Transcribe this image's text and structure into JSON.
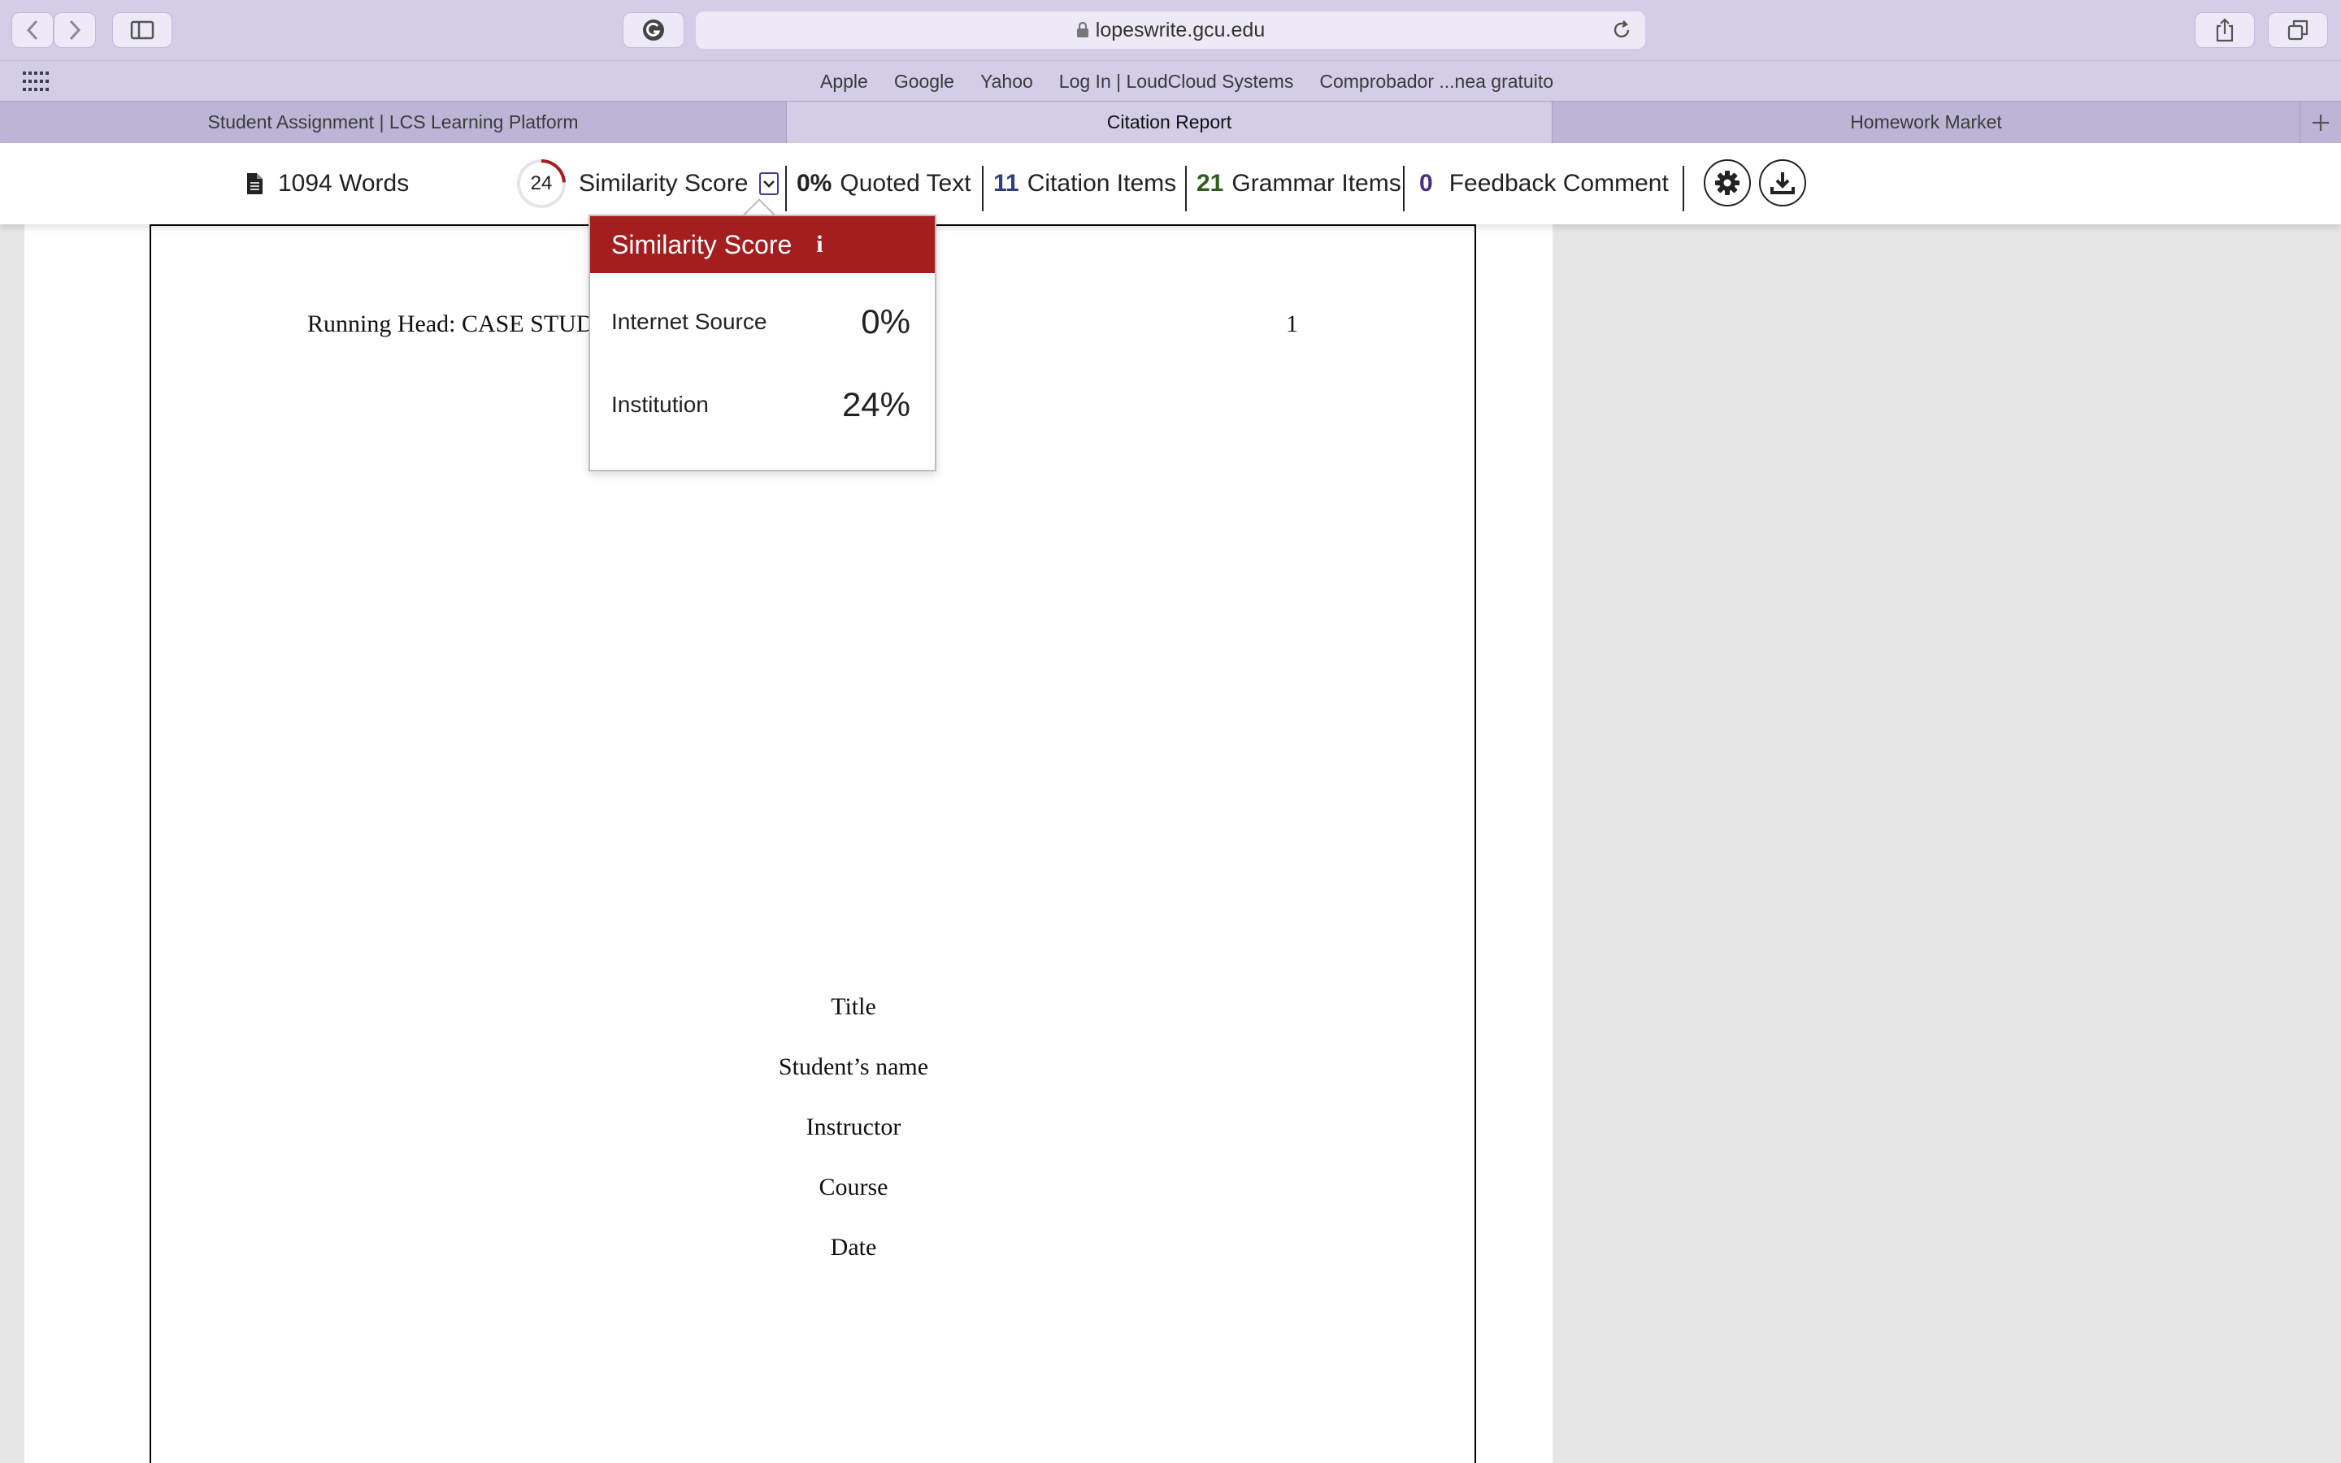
{
  "browser": {
    "url": "lopeswrite.gcu.edu",
    "bookmarks": [
      "Apple",
      "Google",
      "Yahoo",
      "Log In | LoudCloud Systems",
      "Comprobador ...nea gratuito"
    ],
    "tabs": [
      {
        "label": "Student Assignment | LCS Learning Platform",
        "active": false
      },
      {
        "label": "Citation Report",
        "active": true
      },
      {
        "label": "Homework Market",
        "active": false
      }
    ]
  },
  "report_header": {
    "words": "1094 Words",
    "similarity_value": "24",
    "similarity_fraction": 0.24,
    "similarity_label": "Similarity Score",
    "quoted_value": "0%",
    "quoted_label": "Quoted Text",
    "citation_value": "11",
    "citation_label": "Citation Items",
    "grammar_value": "21",
    "grammar_label": "Grammar Items",
    "feedback_value": "0",
    "feedback_label": "Feedback Comment"
  },
  "colors": {
    "brand_red": "#a41e20",
    "citation_blue": "#2f3f86",
    "grammar_green": "#2f5d1f",
    "feedback_purple": "#4a2f86"
  },
  "similarity_popup": {
    "title": "Similarity Score",
    "info_icon": "i",
    "rows": [
      {
        "label": "Internet Source",
        "value": "0%"
      },
      {
        "label": "Institution",
        "value": "24%"
      }
    ]
  },
  "document": {
    "running_head": "Running Head: CASE STUD",
    "page_number": "1",
    "title_lines": [
      "Title",
      "Student’s name",
      "Instructor",
      "Course",
      "Date"
    ]
  }
}
